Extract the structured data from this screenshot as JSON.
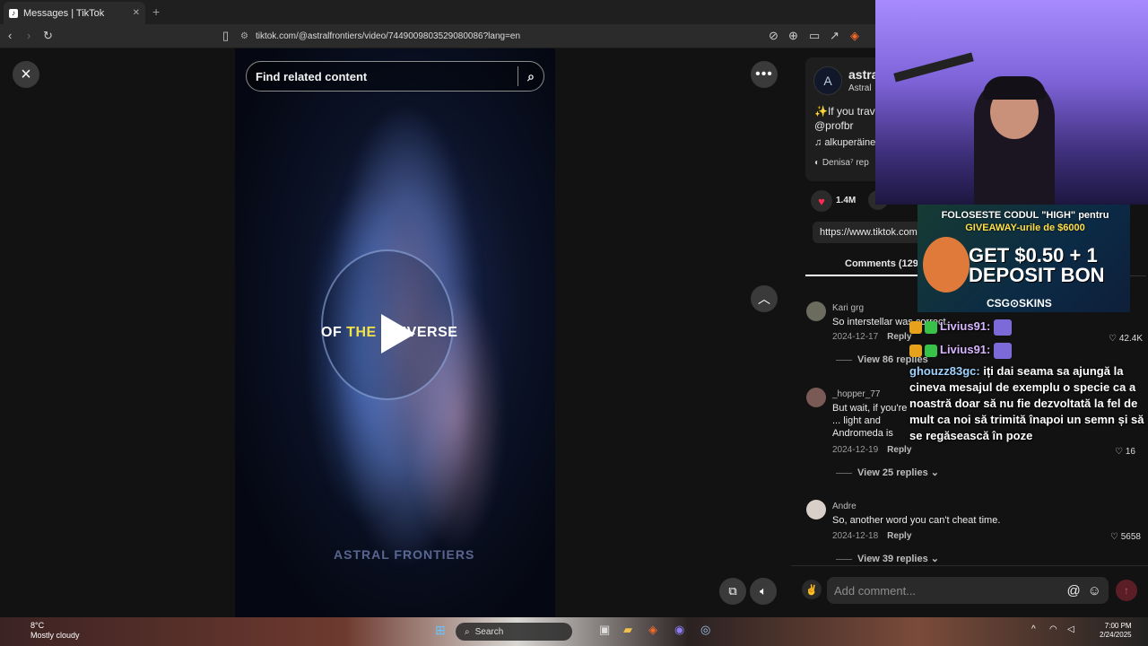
{
  "browser": {
    "tab_title": "Messages | TikTok",
    "tab_close": "✕",
    "new_tab": "+",
    "url": "tiktok.com/@astralfrontiers/video/7449009803529080086?lang=en"
  },
  "video": {
    "search_placeholder": "Find related content",
    "overlay_text_a": "OF ",
    "overlay_text_hl": "THE",
    "overlay_text_b": " UNIVERSE",
    "watermark": "ASTRAL FRONTIERS"
  },
  "author": {
    "name": "astra",
    "sub": "Astral",
    "description": "✨If you trav Cox @profbr",
    "music": "alkuperäine",
    "repost": "Denisa⁷ rep",
    "likes": "1.4M",
    "link": "https://www.tiktok.com"
  },
  "comments_tab": "Comments (129",
  "comments": [
    {
      "user": "Kari grg",
      "text": "So interstellar was correct.",
      "date": "2024-12-17",
      "reply": "Reply",
      "likes": "42.4K",
      "view": "View 86 replies",
      "avatar_color": "#6b6b5e"
    },
    {
      "user": "_hopper_77",
      "text": "But wait, if you're ... light and Andromeda is 2.5M LY from earth, how can you travel there in 1 minute?",
      "date": "2024-12-19",
      "reply": "Reply",
      "likes": "16",
      "view": "View 25 replies",
      "avatar_color": "#7a5a55"
    },
    {
      "user": "Andre",
      "text": "So, another word you can't cheat time.",
      "date": "2024-12-18",
      "reply": "Reply",
      "likes": "5658",
      "view": "View 39 replies",
      "avatar_color": "#d8d0c8"
    }
  ],
  "add_comment_placeholder": "Add comment...",
  "stream": {
    "ad_top_1": "FOLOSESTE CODUL \"HIGH\" pentru",
    "ad_top_2": "GIVEAWAY-urile de $6000",
    "ad_big_1": "GET $0.50 + 1",
    "ad_big_2": "DEPOSIT BON",
    "ad_brand": "CSG⊙SKINS",
    "chat": [
      {
        "name": "Livius91:",
        "msg": ""
      },
      {
        "name": "Livius91:",
        "msg": ""
      },
      {
        "name": "ghouzz83gc:",
        "msg": "iți dai seama sa ajungă la cineva mesajul de exemplu o specie ca a noastră doar să nu fie dezvoltată la fel de mult ca noi să trimită înapoi un semn și să se regăsească în poze"
      }
    ]
  },
  "taskbar": {
    "temp": "8°C",
    "weather": "Mostly cloudy",
    "search": "Search",
    "time": "7:00 PM",
    "date": "2/24/2025"
  },
  "colors": {
    "like": "#ff2b54",
    "accent": "#fe2c55",
    "panel_bg": "#121212"
  }
}
